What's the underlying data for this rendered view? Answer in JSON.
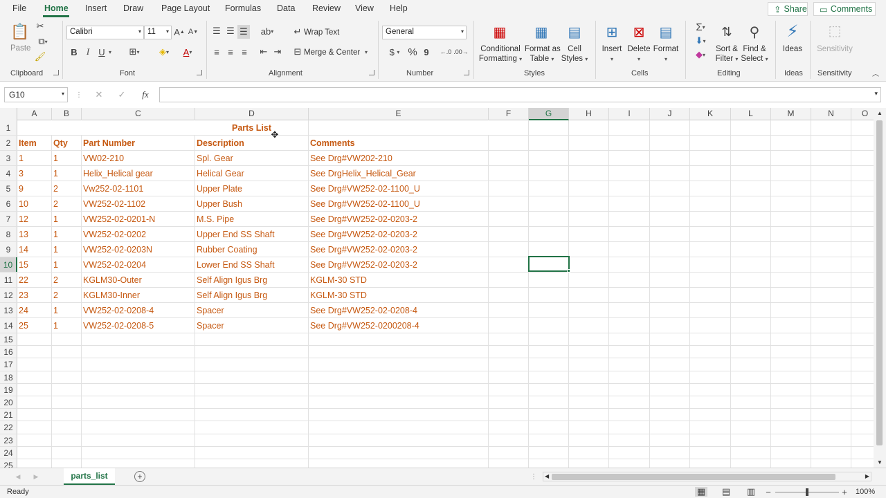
{
  "menu": {
    "tabs": [
      "File",
      "Home",
      "Insert",
      "Draw",
      "Page Layout",
      "Formulas",
      "Data",
      "Review",
      "View",
      "Help"
    ],
    "share": "Share",
    "comments": "Comments"
  },
  "ribbon": {
    "clipboard": {
      "paste": "Paste",
      "label": "Clipboard"
    },
    "font": {
      "name": "Calibri",
      "size": "11",
      "bold": "B",
      "italic": "I",
      "underline": "U",
      "label": "Font"
    },
    "alignment": {
      "wrap_text": "Wrap Text",
      "merge_center": "Merge & Center",
      "label": "Alignment"
    },
    "number": {
      "format": "General",
      "currency": "$",
      "percent": "%",
      "comma": "9",
      "label": "Number"
    },
    "styles": {
      "conditional": "Conditional",
      "formatting": "Formatting",
      "format_as": "Format as",
      "table": "Table",
      "cell": "Cell",
      "cell_styles": "Styles",
      "label": "Styles"
    },
    "cells": {
      "insert": "Insert",
      "delete": "Delete",
      "format": "Format",
      "label": "Cells"
    },
    "editing": {
      "sort": "Sort &",
      "filter": "Filter",
      "find": "Find &",
      "select": "Select",
      "label": "Editing"
    },
    "ideas": {
      "btn": "Ideas",
      "label": "Ideas"
    },
    "sensitivity": {
      "btn": "Sensitivity",
      "label": "Sensitivity"
    }
  },
  "formula": {
    "namebox": "G10",
    "fx": "fx"
  },
  "columns": [
    "A",
    "B",
    "C",
    "D",
    "E",
    "F",
    "G",
    "H",
    "I",
    "J",
    "K",
    "L",
    "M",
    "N",
    "O"
  ],
  "sheet": {
    "title": "Parts List",
    "headers": [
      "Item",
      "Qty",
      "Part Number",
      "Description",
      "Comments"
    ],
    "rows": [
      [
        "1",
        "1",
        "VW02-210",
        "Spl. Gear",
        "See Drg#VW202-210"
      ],
      [
        "3",
        "1",
        "Helix_Helical gear",
        "Helical Gear",
        "See DrgHelix_Helical_Gear"
      ],
      [
        "9",
        "2",
        "Vw252-02-1101",
        "Upper Plate",
        "See Drg#VW252-02-1100_U"
      ],
      [
        "10",
        "2",
        "VW252-02-1102",
        "Upper Bush",
        "See Drg#VW252-02-1100_U"
      ],
      [
        "12",
        "1",
        "VW252-02-0201-N",
        "M.S. Pipe",
        "See Drg#VW252-02-0203-2"
      ],
      [
        "13",
        "1",
        "VW252-02-0202",
        "Upper End SS Shaft",
        "See Drg#VW252-02-0203-2"
      ],
      [
        "14",
        "1",
        "VW252-02-0203N",
        "Rubber Coating",
        "See Drg#VW252-02-0203-2"
      ],
      [
        "15",
        "1",
        "VW252-02-0204",
        "Lower End SS Shaft",
        "See Drg#VW252-02-0203-2"
      ],
      [
        "22",
        "2",
        "KGLM30-Outer",
        "Self Align Igus Brg",
        "KGLM-30 STD"
      ],
      [
        "23",
        "2",
        "KGLM30-Inner",
        "Self Align Igus Brg",
        "KGLM-30 STD"
      ],
      [
        "24",
        "1",
        "VW252-02-0208-4",
        "Spacer",
        "See Drg#VW252-02-0208-4"
      ],
      [
        "25",
        "1",
        "VW252-02-0208-5",
        "Spacer",
        "See Drg#VW252-0200208-4"
      ]
    ],
    "row_numbers": [
      "1",
      "2",
      "3",
      "4",
      "5",
      "6",
      "7",
      "8",
      "9",
      "10",
      "11",
      "12",
      "13",
      "14",
      "15",
      "16",
      "17",
      "18",
      "19",
      "20",
      "21",
      "22",
      "23",
      "24",
      "25"
    ]
  },
  "tabs": {
    "sheet": "parts_list",
    "add": "+"
  },
  "status": {
    "ready": "Ready",
    "zoom": "100%"
  },
  "colors": {
    "accent": "#217346",
    "cell_text": "#c65911"
  }
}
